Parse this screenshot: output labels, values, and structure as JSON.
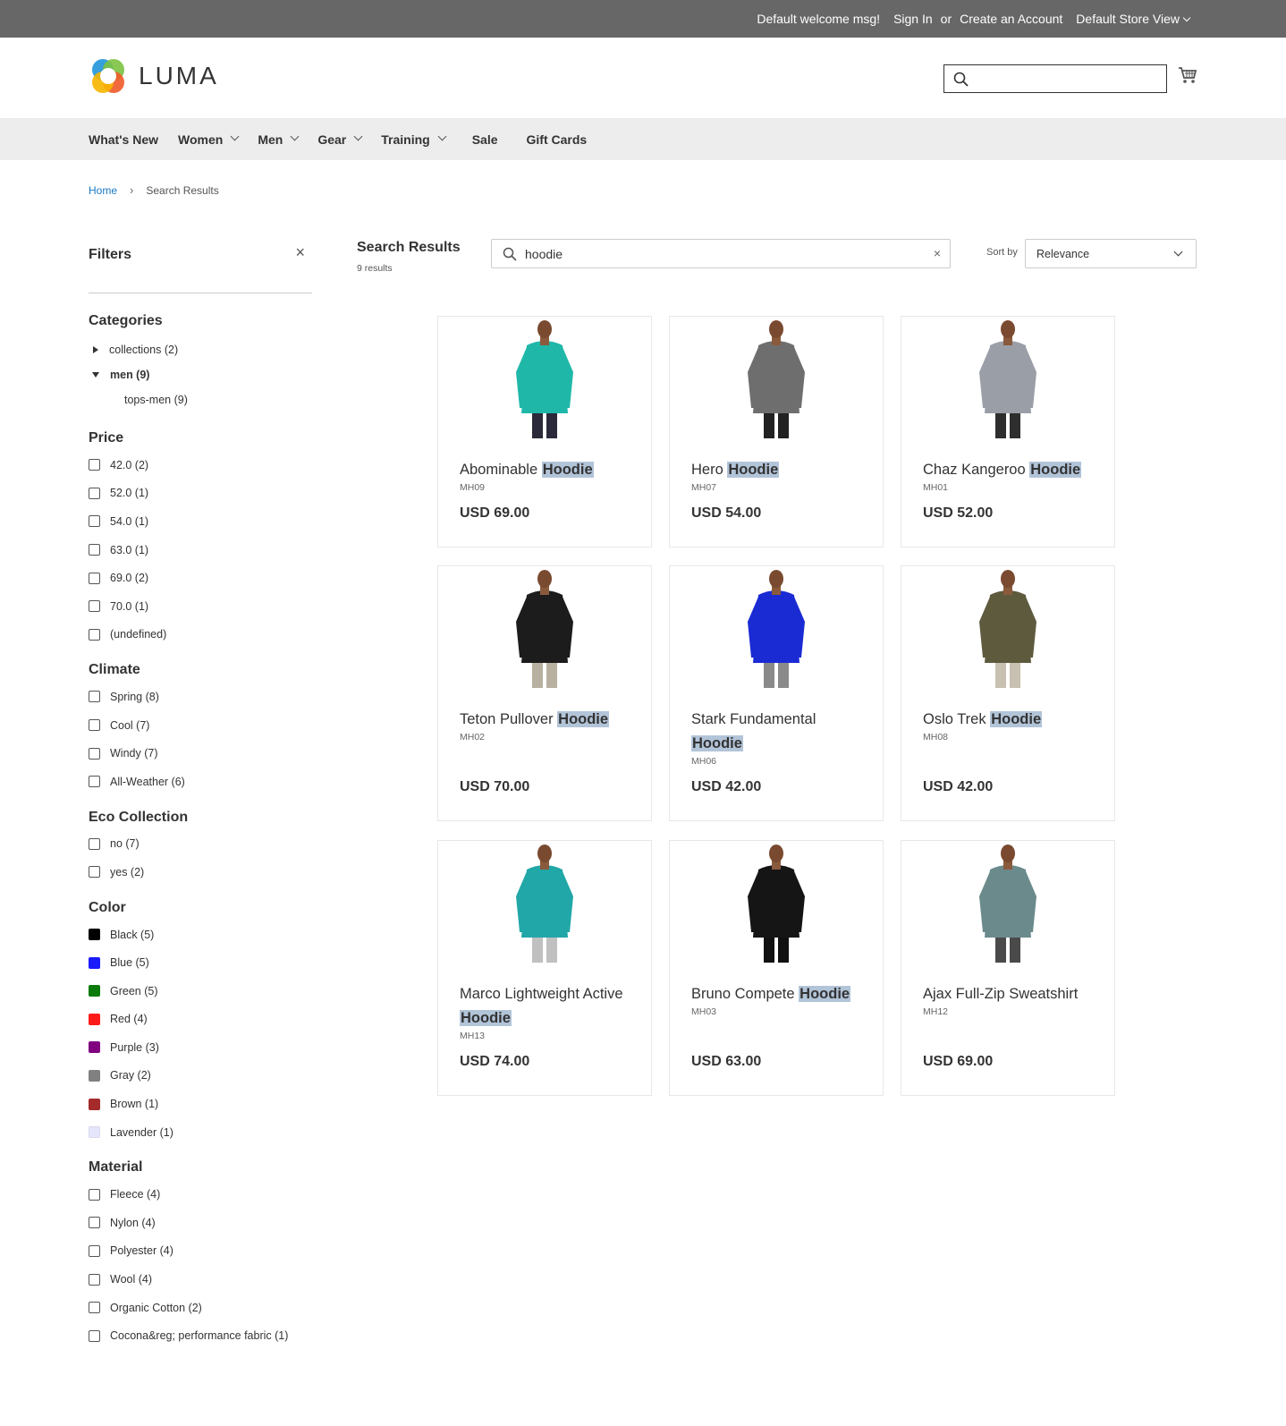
{
  "topbar": {
    "welcome": "Default welcome msg!",
    "sign_in": "Sign In",
    "or": "or",
    "create_account": "Create an Account",
    "store_view": "Default Store View"
  },
  "header": {
    "logo_text": "LUMA",
    "search_placeholder": ""
  },
  "nav": {
    "items": [
      {
        "label": "What's New",
        "dropdown": false
      },
      {
        "label": "Women",
        "dropdown": true
      },
      {
        "label": "Men",
        "dropdown": true
      },
      {
        "label": "Gear",
        "dropdown": true
      },
      {
        "label": "Training",
        "dropdown": true
      },
      {
        "label": "Sale",
        "dropdown": false
      },
      {
        "label": "Gift Cards",
        "dropdown": false
      }
    ]
  },
  "breadcrumb": {
    "home": "Home",
    "current": "Search Results"
  },
  "filters": {
    "title": "Filters",
    "close": "×",
    "categories": {
      "title": "Categories",
      "items": [
        {
          "label": "collections (2)",
          "state": "collapsed"
        },
        {
          "label": "men (9)",
          "state": "expanded"
        },
        {
          "label": "tops-men (9)",
          "state": "child"
        }
      ]
    },
    "price": {
      "title": "Price",
      "options": [
        "42.0 (2)",
        "52.0 (1)",
        "54.0 (1)",
        "63.0 (1)",
        "69.0 (2)",
        "70.0 (1)",
        "(undefined)"
      ]
    },
    "climate": {
      "title": "Climate",
      "options": [
        "Spring (8)",
        "Cool (7)",
        "Windy (7)",
        "All-Weather (6)"
      ]
    },
    "eco": {
      "title": "Eco Collection",
      "options": [
        "no (7)",
        "yes (2)"
      ]
    },
    "color": {
      "title": "Color",
      "options": [
        {
          "label": "Black (5)",
          "color": "#000000"
        },
        {
          "label": "Blue (5)",
          "color": "#1a1aff"
        },
        {
          "label": "Green (5)",
          "color": "#0a7a0a"
        },
        {
          "label": "Red (4)",
          "color": "#ff1a1a"
        },
        {
          "label": "Purple (3)",
          "color": "#800080"
        },
        {
          "label": "Gray (2)",
          "color": "#808080"
        },
        {
          "label": "Brown (1)",
          "color": "#a52a2a"
        },
        {
          "label": "Lavender (1)",
          "color": "#e6e6fa"
        }
      ]
    },
    "material": {
      "title": "Material",
      "options": [
        "Fleece (4)",
        "Nylon (4)",
        "Polyester (4)",
        "Wool (4)",
        "Organic Cotton (2)",
        "Cocona&reg; performance fabric (1)"
      ]
    }
  },
  "results": {
    "title": "Search Results",
    "count": "9 results",
    "query": "hoodie",
    "clear": "×",
    "sort_label": "Sort by",
    "sort_value": "Relevance"
  },
  "products": [
    {
      "name": "Abominable",
      "highlight": "Hoodie",
      "sku": "MH09",
      "price": "USD 69.00",
      "shirt": "#1fb8a8",
      "pants": "#2a2a3a"
    },
    {
      "name": "Hero",
      "highlight": "Hoodie",
      "sku": "MH07",
      "price": "USD 54.00",
      "shirt": "#6e6e6e",
      "pants": "#222222"
    },
    {
      "name": "Chaz Kangeroo",
      "highlight": "Hoodie",
      "sku": "MH01",
      "price": "USD 52.00",
      "shirt": "#9a9ea6",
      "pants": "#2e2e2e"
    },
    {
      "name": "Teton Pullover",
      "highlight": "Hoodie",
      "sku": "MH02",
      "price": "USD 70.00",
      "shirt": "#1c1c1c",
      "pants": "#b8b0a0"
    },
    {
      "name": "Stark Fundamental",
      "highlight": "Hoodie",
      "sku": "MH06",
      "price": "USD 42.00",
      "shirt": "#1a2bd4",
      "pants": "#8a8a8a"
    },
    {
      "name": "Oslo Trek",
      "highlight": "Hoodie",
      "sku": "MH08",
      "price": "USD 42.00",
      "shirt": "#5e5a3e",
      "pants": "#c8c0b0"
    },
    {
      "name": "Marco Lightweight Active",
      "highlight": "Hoodie",
      "sku": "MH13",
      "price": "USD 74.00",
      "shirt": "#22a7a8",
      "pants": "#c0c0c0"
    },
    {
      "name": "Bruno Compete",
      "highlight": "Hoodie",
      "sku": "MH03",
      "price": "USD 63.00",
      "shirt": "#151515",
      "pants": "#111111"
    },
    {
      "name": "Ajax Full-Zip Sweatshirt",
      "highlight": "",
      "sku": "MH12",
      "price": "USD 69.00",
      "shirt": "#6b8a8c",
      "pants": "#4a4a4a"
    }
  ]
}
